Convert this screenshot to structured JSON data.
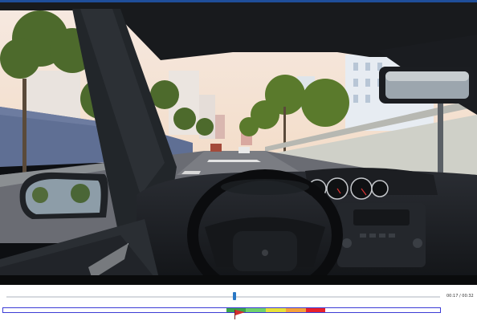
{
  "player": {
    "time_display": "00:17 / 00:32",
    "progress": 0.53
  },
  "timeline": {
    "segments": [
      {
        "name": "green-dark",
        "color": "#3aa54a"
      },
      {
        "name": "green-light",
        "color": "#6fd16c"
      },
      {
        "name": "yellow",
        "color": "#e8e23b"
      },
      {
        "name": "orange",
        "color": "#f5a13a"
      },
      {
        "name": "red",
        "color": "#e8212b"
      }
    ],
    "marker_icon": "flag-icon",
    "border_color": "#3b3bd6"
  },
  "colors": {
    "top_bar": "#1f4e9a",
    "seek_handle": "#2a78c5"
  }
}
